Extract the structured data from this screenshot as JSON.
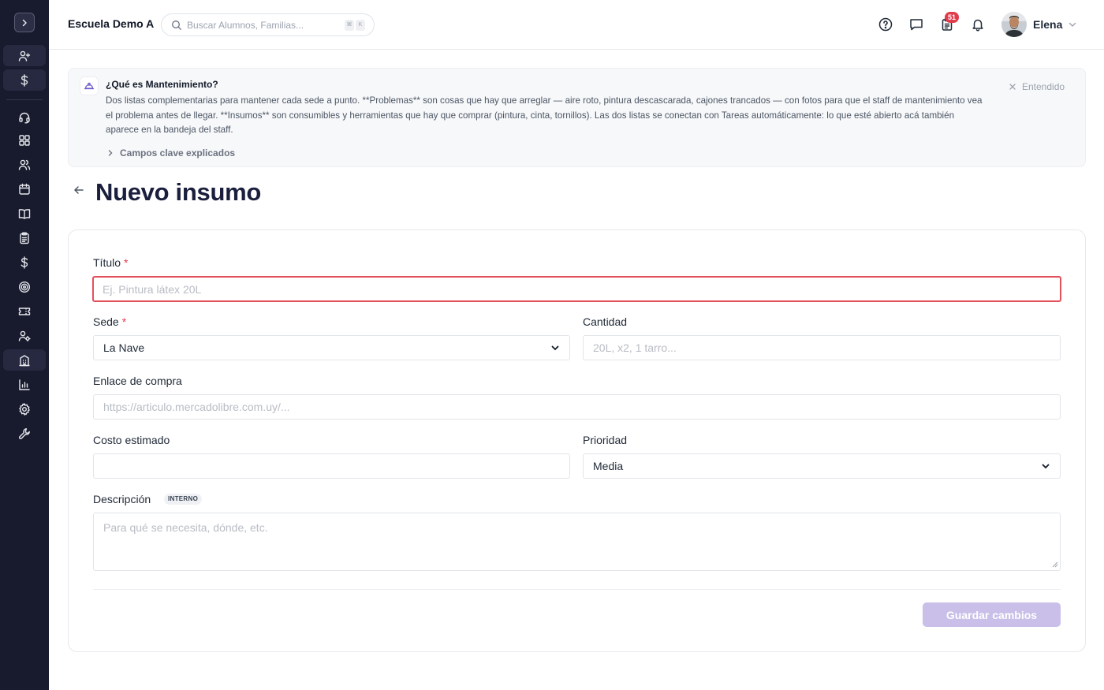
{
  "header": {
    "school_name": "Escuela Demo A",
    "search_placeholder": "Buscar Alumnos, Familias...",
    "search_shortcut": [
      "⌘",
      "K"
    ],
    "notification_count": "51",
    "user_name": "Elena"
  },
  "sidebar": {
    "icons": [
      "chevron-right-icon",
      "user-plus-icon",
      "dollar-icon",
      "headset-icon",
      "dashboard-icon",
      "users-icon",
      "calendar-icon",
      "book-icon",
      "clipboard-icon",
      "dollar-icon",
      "target-icon",
      "ticket-icon",
      "user-gear-icon",
      "building-icon",
      "chart-icon",
      "settings-icon",
      "wrench-icon"
    ],
    "active_item": "building-icon"
  },
  "info_banner": {
    "title": "¿Qué es Mantenimiento?",
    "body": "Dos listas complementarias para mantener cada sede a punto. **Problemas** son cosas que hay que arreglar — aire roto, pintura descascarada, cajones trancados — con fotos para que el staff de mantenimiento vea el problema antes de llegar. **Insumos** son consumibles y herramientas que hay que comprar (pintura, cinta, tornillos). Las dos listas se conectan con Tareas automáticamente: lo que esté abierto acá también aparece en la bandeja del staff.",
    "dismiss_label": "Entendido",
    "expand_label": "Campos clave explicados"
  },
  "page": {
    "title": "Nuevo insumo"
  },
  "form": {
    "title_label": "Título",
    "title_placeholder": "Ej. Pintura látex 20L",
    "sede_label": "Sede",
    "sede_value": "La Nave",
    "cantidad_label": "Cantidad",
    "cantidad_placeholder": "20L, x2, 1 tarro...",
    "enlace_label": "Enlace de compra",
    "enlace_placeholder": "https://articulo.mercadolibre.com.uy/...",
    "costo_label": "Costo estimado",
    "costo_value": "",
    "prioridad_label": "Prioridad",
    "prioridad_value": "Media",
    "descripcion_label": "Descripción",
    "descripcion_tag": "INTERNO",
    "descripcion_placeholder": "Para qué se necesita, dónde, etc.",
    "required_marker": "*",
    "save_label": "Guardar cambios"
  },
  "colors": {
    "sidebar_bg": "#181a2e",
    "title_color": "#1a1f3d",
    "error_border": "#e3505c",
    "required": "#e23b4b",
    "save_button_disabled": "#c9bfe9",
    "badge": "#e23b4b"
  }
}
